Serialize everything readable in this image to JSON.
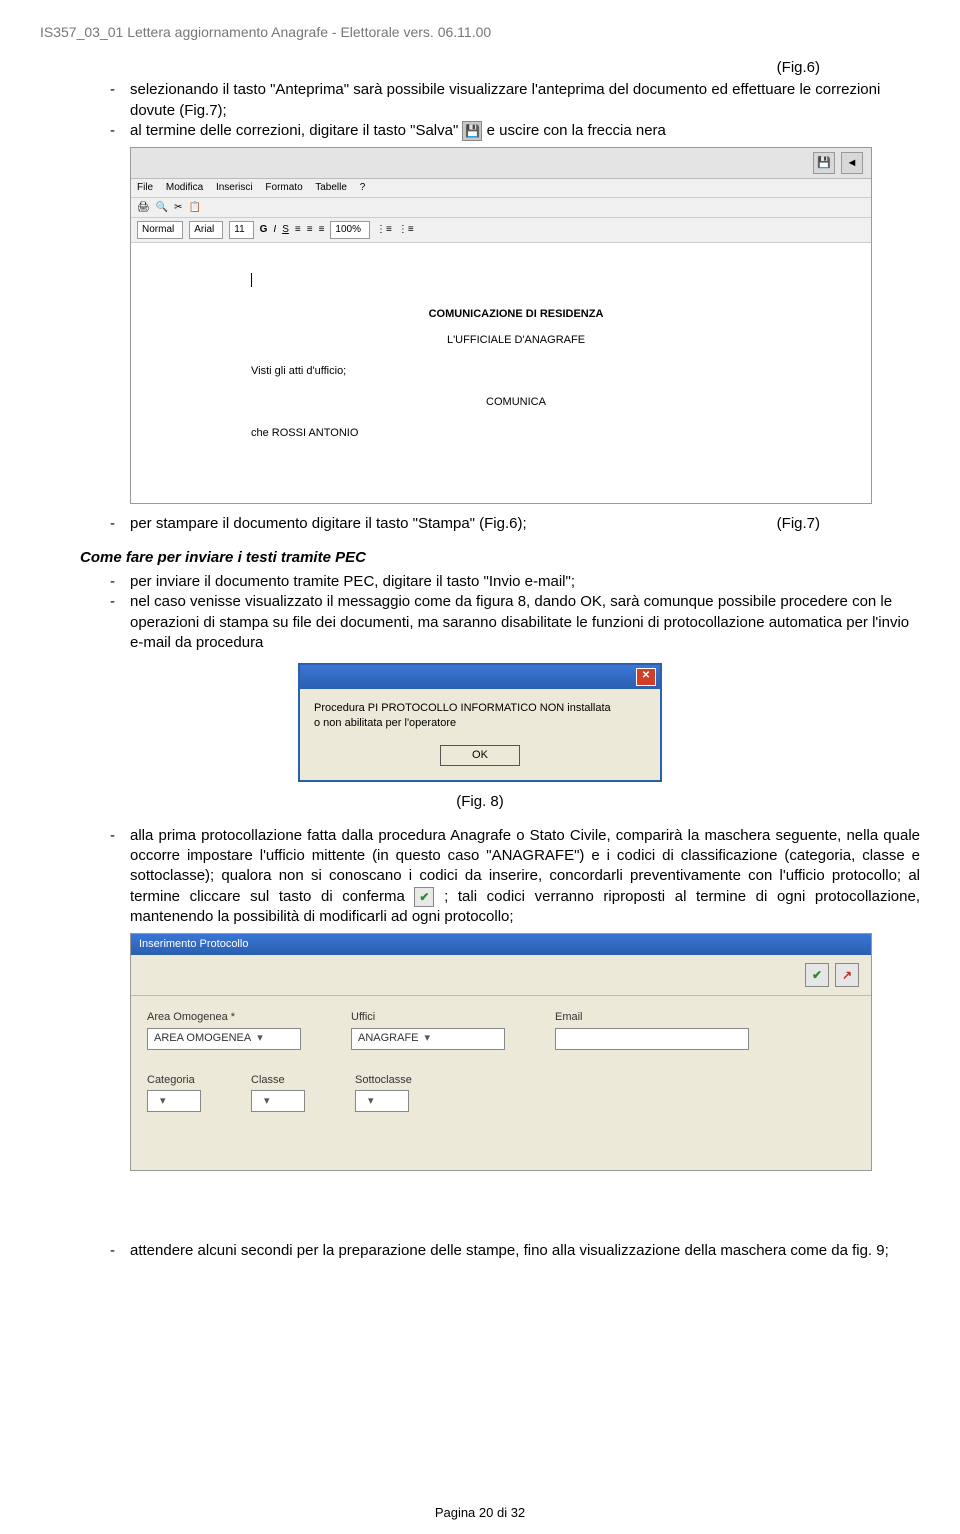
{
  "doc_header": "IS357_03_01 Lettera aggiornamento Anagrafe - Elettorale vers. 06.11.00",
  "fig6_label": "(Fig.6)",
  "b1": "selezionando il tasto \"Anteprima\" sarà possibile visualizzare l'anteprima del documento ed effettuare le correzioni dovute (Fig.7);",
  "b2_pre": "al termine delle correzioni, digitare il tasto \"Salva\" ",
  "b2_post": " e uscire con la freccia nera",
  "editor": {
    "menu": [
      "File",
      "Modifica",
      "Inserisci",
      "Formato",
      "Tabelle",
      "?"
    ],
    "style": "Normal",
    "font": "Arial",
    "size": "11",
    "zoom": "100%",
    "doc_title": "COMUNICAZIONE DI RESIDENZA",
    "doc_sender": "L'UFFICIALE D'ANAGRAFE",
    "doc_line1": "Visti gli atti d'ufficio;",
    "doc_verb": "COMUNICA",
    "doc_line2": "che ROSSI ANTONIO"
  },
  "b3": "per stampare il documento digitare il tasto \"Stampa\" (Fig.6);",
  "fig7_label": "(Fig.7)",
  "pec_heading": "Come fare per inviare i testi tramite PEC",
  "pec1": "per inviare il documento tramite PEC, digitare il tasto \"Invio e-mail\";",
  "pec2": "nel caso venisse visualizzato il messaggio come da figura 8, dando OK, sarà comunque possibile procedere con le operazioni di stampa su file dei documenti, ma saranno disabilitate le funzioni di protocollazione automatica per l'invio e-mail da procedura",
  "dialog": {
    "line1": "Procedura PI PROTOCOLLO INFORMATICO NON installata",
    "line2": "o non abilitata per l'operatore",
    "ok": "OK"
  },
  "fig8_label": "(Fig. 8)",
  "b4_pre": "alla prima protocollazione fatta dalla procedura Anagrafe o Stato Civile, comparirà la maschera seguente, nella quale occorre impostare l'ufficio mittente (in questo caso \"ANAGRAFE\") e i codici di classificazione (categoria, classe e sottoclasse); qualora non si conoscano i codici da inserire, concordarli preventivamente con l'ufficio protocollo; al termine cliccare sul tasto di conferma ",
  "b4_post": "; tali codici verranno riproposti al termine di ogni protocollazione, mantenendo la possibilità di modificarli ad ogni protocollo;",
  "protocol": {
    "title": "Inserimento Protocollo",
    "fields": {
      "area_lbl": "Area Omogenea *",
      "area_val": "AREA OMOGENEA",
      "uffici_lbl": "Uffici",
      "uffici_val": "ANAGRAFE",
      "email_lbl": "Email",
      "email_val": "",
      "categoria_lbl": "Categoria",
      "classe_lbl": "Classe",
      "sottoclasse_lbl": "Sottoclasse"
    }
  },
  "b5": "attendere alcuni secondi per la preparazione delle stampe, fino alla visualizzazione della maschera come da fig. 9;",
  "footer": "Pagina 20 di 32"
}
